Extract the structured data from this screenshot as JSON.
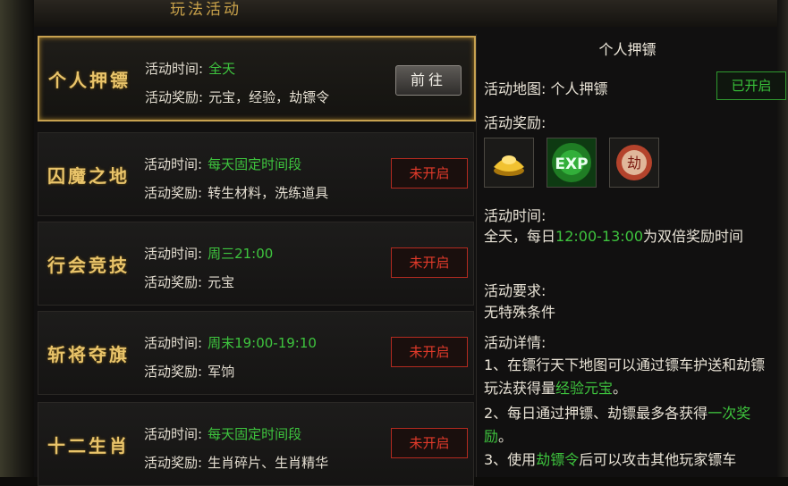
{
  "header": {
    "title": "玩法活动"
  },
  "activities": [
    {
      "name": "个人押镖",
      "time_label": "活动时间:",
      "time": "全天",
      "reward_label": "活动奖励:",
      "reward": "元宝，经验，劫镖令",
      "button": "前往"
    },
    {
      "name": "囚魔之地",
      "time_label": "活动时间:",
      "time": "每天固定时间段",
      "reward_label": "活动奖励:",
      "reward": "转生材料，洗练道具",
      "button": "未开启"
    },
    {
      "name": "行会竞技",
      "time_label": "活动时间:",
      "time": "周三21:00",
      "reward_label": "活动奖励:",
      "reward": "元宝",
      "button": "未开启"
    },
    {
      "name": "斩将夺旗",
      "time_label": "活动时间:",
      "time": "周末19:00-19:10",
      "reward_label": "活动奖励:",
      "reward": "军饷",
      "button": "未开启"
    },
    {
      "name": "十二生肖",
      "time_label": "活动时间:",
      "time": "每天固定时间段",
      "reward_label": "活动奖励:",
      "reward": "生肖碎片、生肖精华",
      "button": "未开启"
    }
  ],
  "detail": {
    "title": "个人押镖",
    "map_label": "活动地图:",
    "map_value": "个人押镖",
    "status": "已开启",
    "reward_label": "活动奖励:",
    "reward_icons": [
      "gold-ingot-icon",
      "exp-icon",
      "escort-token-icon"
    ],
    "exp_text": "EXP",
    "token_text": "劫",
    "time_label": "活动时间:",
    "time_pre": "全天，每日",
    "time_hl": "12:00-13:00",
    "time_post": "为双倍奖励时间",
    "req_label": "活动要求:",
    "req_value": "无特殊条件",
    "detail_label": "活动详情:",
    "p1_pre": "1、在镖行天下地图可以通过镖车护送和劫镖玩法获得量",
    "p1_hl": "经验元宝",
    "p1_post": "。",
    "p2_pre": "2、每日通过押镖、劫镖最多各获得",
    "p2_hl": "一次奖励",
    "p2_post": "。",
    "p3_pre": "3、使用",
    "p3_hl": "劫镖令",
    "p3_post": "后可以攻击其他玩家镖车"
  },
  "colors": {
    "gold": "#e9c46a",
    "green": "#3ec43e",
    "red": "#e23a2a",
    "border_gold": "#c7a150"
  }
}
